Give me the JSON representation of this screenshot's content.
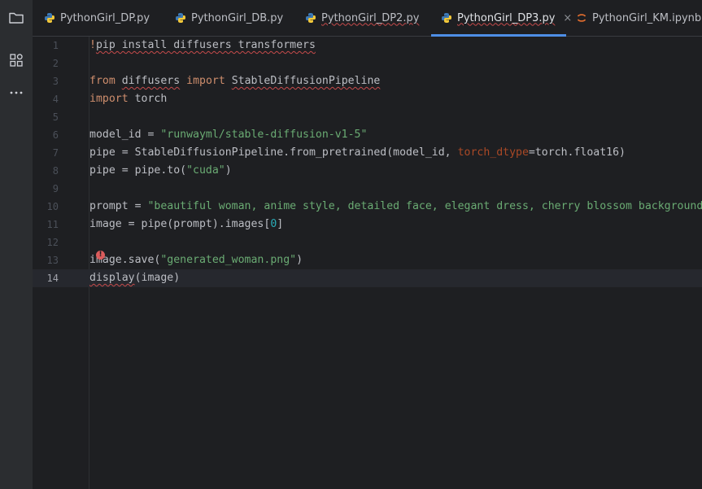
{
  "tabs": [
    {
      "label": "PythonGirl_DP.py",
      "icon": "python-icon",
      "active": false,
      "error": false
    },
    {
      "label": "PythonGirl_DB.py",
      "icon": "python-icon",
      "active": false,
      "error": false
    },
    {
      "label": "PythonGirl_DP2.py",
      "icon": "python-icon",
      "active": false,
      "error": true
    },
    {
      "label": "PythonGirl_DP3.py",
      "icon": "python-icon",
      "active": true,
      "error": true,
      "close": "×"
    },
    {
      "label": "PythonGirl_KM.ipynb",
      "icon": "jupyter-icon",
      "active": false,
      "error": false
    }
  ],
  "toolbar": {
    "icons": [
      "folder-icon",
      "structure-icon",
      "more-icon"
    ]
  },
  "editor": {
    "current_line": 14,
    "lines": [
      {
        "n": "1",
        "text": "!pip install diffusers transformers"
      },
      {
        "n": "2",
        "text": ""
      },
      {
        "n": "3",
        "text": "from diffusers import StableDiffusionPipeline"
      },
      {
        "n": "4",
        "text": "import torch"
      },
      {
        "n": "5",
        "text": ""
      },
      {
        "n": "6",
        "text": "model_id = \"runwayml/stable-diffusion-v1-5\""
      },
      {
        "n": "7",
        "text": "pipe = StableDiffusionPipeline.from_pretrained(model_id, torch_dtype=torch.float16)"
      },
      {
        "n": "8",
        "text": "pipe = pipe.to(\"cuda\")"
      },
      {
        "n": "9",
        "text": ""
      },
      {
        "n": "10",
        "text": "prompt = \"beautiful woman, anime style, detailed face, elegant dress, cherry blossom background"
      },
      {
        "n": "11",
        "text": "image = pipe(prompt).images[0]"
      },
      {
        "n": "12",
        "text": ""
      },
      {
        "n": "13",
        "text": "image.save(\"generated_woman.png\")"
      },
      {
        "n": "14",
        "text": "display(image)"
      }
    ]
  },
  "colors": {
    "keyword": "#cf8e6d",
    "string": "#6aab73",
    "number": "#2aacb8",
    "param": "#aa4926",
    "accent": "#4e8ee6",
    "error": "#db5c5c"
  }
}
